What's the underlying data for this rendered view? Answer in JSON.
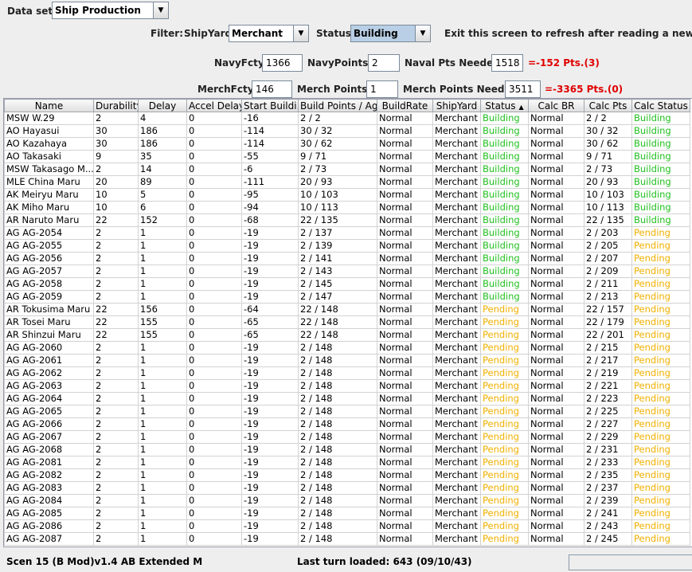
{
  "dataset": {
    "label": "Data set:",
    "value": "Ship Production"
  },
  "filter": {
    "label": "Filter:",
    "shipyard_label": "ShipYard:",
    "shipyard_value": "Merchant",
    "status_label": "Status:",
    "status_value": "Building",
    "exit_message": "Exit this screen to refresh after reading a new turn"
  },
  "navy": {
    "fcty_label": "NavyFcty:",
    "fcty_value": "1366",
    "points_label": "NavyPoints:",
    "points_value": "2",
    "needed_label": "Naval Pts Needed:",
    "needed_value": "1518",
    "deficit": "=-152 Pts.(3)"
  },
  "merch": {
    "fcty_label": "MerchFcty:",
    "fcty_value": "146",
    "points_label": "Merch Points:",
    "points_value": "1",
    "needed_label": "Merch Points Needed:",
    "needed_value": "3511",
    "deficit": "=-3365 Pts.(0)"
  },
  "table": {
    "columns": [
      "Name",
      "Durability",
      "Delay",
      "Accel Delay",
      "Start Buildi...",
      "Build Points / Ag...",
      "BuildRate",
      "ShipYard",
      "Status",
      "Calc BR",
      "Calc Pts",
      "Calc Status"
    ],
    "sort_indicator": "▲",
    "rows": [
      [
        "MSW W.29",
        "2",
        "4",
        "0",
        "-16",
        "2 / 2",
        "Normal",
        "Merchant",
        "Building",
        "Normal",
        "2 / 2",
        "Building"
      ],
      [
        "AO Hayasui",
        "30",
        "186",
        "0",
        "-114",
        "30 / 32",
        "Normal",
        "Merchant",
        "Building",
        "Normal",
        "30 / 32",
        "Building"
      ],
      [
        "AO Kazahaya",
        "30",
        "186",
        "0",
        "-114",
        "30 / 62",
        "Normal",
        "Merchant",
        "Building",
        "Normal",
        "30 / 62",
        "Building"
      ],
      [
        "AO Takasaki",
        "9",
        "35",
        "0",
        "-55",
        "9 / 71",
        "Normal",
        "Merchant",
        "Building",
        "Normal",
        "9 / 71",
        "Building"
      ],
      [
        "MSW Takasago M...",
        "2",
        "14",
        "0",
        "-6",
        "2 / 73",
        "Normal",
        "Merchant",
        "Building",
        "Normal",
        "2 / 73",
        "Building"
      ],
      [
        "MLE China Maru",
        "20",
        "89",
        "0",
        "-111",
        "20 / 93",
        "Normal",
        "Merchant",
        "Building",
        "Normal",
        "20 / 93",
        "Building"
      ],
      [
        "AK Meiryu Maru",
        "10",
        "5",
        "0",
        "-95",
        "10 / 103",
        "Normal",
        "Merchant",
        "Building",
        "Normal",
        "10 / 103",
        "Building"
      ],
      [
        "AK Miho Maru",
        "10",
        "6",
        "0",
        "-94",
        "10 / 113",
        "Normal",
        "Merchant",
        "Building",
        "Normal",
        "10 / 113",
        "Building"
      ],
      [
        "AR Naruto Maru",
        "22",
        "152",
        "0",
        "-68",
        "22 / 135",
        "Normal",
        "Merchant",
        "Building",
        "Normal",
        "22 / 135",
        "Building"
      ],
      [
        "AG AG-2054",
        "2",
        "1",
        "0",
        "-19",
        "2 / 137",
        "Normal",
        "Merchant",
        "Building",
        "Normal",
        "2 / 203",
        "Pending"
      ],
      [
        "AG AG-2055",
        "2",
        "1",
        "0",
        "-19",
        "2 / 139",
        "Normal",
        "Merchant",
        "Building",
        "Normal",
        "2 / 205",
        "Pending"
      ],
      [
        "AG AG-2056",
        "2",
        "1",
        "0",
        "-19",
        "2 / 141",
        "Normal",
        "Merchant",
        "Building",
        "Normal",
        "2 / 207",
        "Pending"
      ],
      [
        "AG AG-2057",
        "2",
        "1",
        "0",
        "-19",
        "2 / 143",
        "Normal",
        "Merchant",
        "Building",
        "Normal",
        "2 / 209",
        "Pending"
      ],
      [
        "AG AG-2058",
        "2",
        "1",
        "0",
        "-19",
        "2 / 145",
        "Normal",
        "Merchant",
        "Building",
        "Normal",
        "2 / 211",
        "Pending"
      ],
      [
        "AG AG-2059",
        "2",
        "1",
        "0",
        "-19",
        "2 / 147",
        "Normal",
        "Merchant",
        "Building",
        "Normal",
        "2 / 213",
        "Pending"
      ],
      [
        "AR Tokusima Maru",
        "22",
        "156",
        "0",
        "-64",
        "22 / 148",
        "Normal",
        "Merchant",
        "Pending",
        "Normal",
        "22 / 157",
        "Pending"
      ],
      [
        "AR Tosei Maru",
        "22",
        "155",
        "0",
        "-65",
        "22 / 148",
        "Normal",
        "Merchant",
        "Pending",
        "Normal",
        "22 / 179",
        "Pending"
      ],
      [
        "AR Shinzui Maru",
        "22",
        "155",
        "0",
        "-65",
        "22 / 148",
        "Normal",
        "Merchant",
        "Pending",
        "Normal",
        "22 / 201",
        "Pending"
      ],
      [
        "AG AG-2060",
        "2",
        "1",
        "0",
        "-19",
        "2 / 148",
        "Normal",
        "Merchant",
        "Pending",
        "Normal",
        "2 / 215",
        "Pending"
      ],
      [
        "AG AG-2061",
        "2",
        "1",
        "0",
        "-19",
        "2 / 148",
        "Normal",
        "Merchant",
        "Pending",
        "Normal",
        "2 / 217",
        "Pending"
      ],
      [
        "AG AG-2062",
        "2",
        "1",
        "0",
        "-19",
        "2 / 148",
        "Normal",
        "Merchant",
        "Pending",
        "Normal",
        "2 / 219",
        "Pending"
      ],
      [
        "AG AG-2063",
        "2",
        "1",
        "0",
        "-19",
        "2 / 148",
        "Normal",
        "Merchant",
        "Pending",
        "Normal",
        "2 / 221",
        "Pending"
      ],
      [
        "AG AG-2064",
        "2",
        "1",
        "0",
        "-19",
        "2 / 148",
        "Normal",
        "Merchant",
        "Pending",
        "Normal",
        "2 / 223",
        "Pending"
      ],
      [
        "AG AG-2065",
        "2",
        "1",
        "0",
        "-19",
        "2 / 148",
        "Normal",
        "Merchant",
        "Pending",
        "Normal",
        "2 / 225",
        "Pending"
      ],
      [
        "AG AG-2066",
        "2",
        "1",
        "0",
        "-19",
        "2 / 148",
        "Normal",
        "Merchant",
        "Pending",
        "Normal",
        "2 / 227",
        "Pending"
      ],
      [
        "AG AG-2067",
        "2",
        "1",
        "0",
        "-19",
        "2 / 148",
        "Normal",
        "Merchant",
        "Pending",
        "Normal",
        "2 / 229",
        "Pending"
      ],
      [
        "AG AG-2068",
        "2",
        "1",
        "0",
        "-19",
        "2 / 148",
        "Normal",
        "Merchant",
        "Pending",
        "Normal",
        "2 / 231",
        "Pending"
      ],
      [
        "AG AG-2081",
        "2",
        "1",
        "0",
        "-19",
        "2 / 148",
        "Normal",
        "Merchant",
        "Pending",
        "Normal",
        "2 / 233",
        "Pending"
      ],
      [
        "AG AG-2082",
        "2",
        "1",
        "0",
        "-19",
        "2 / 148",
        "Normal",
        "Merchant",
        "Pending",
        "Normal",
        "2 / 235",
        "Pending"
      ],
      [
        "AG AG-2083",
        "2",
        "1",
        "0",
        "-19",
        "2 / 148",
        "Normal",
        "Merchant",
        "Pending",
        "Normal",
        "2 / 237",
        "Pending"
      ],
      [
        "AG AG-2084",
        "2",
        "1",
        "0",
        "-19",
        "2 / 148",
        "Normal",
        "Merchant",
        "Pending",
        "Normal",
        "2 / 239",
        "Pending"
      ],
      [
        "AG AG-2085",
        "2",
        "1",
        "0",
        "-19",
        "2 / 148",
        "Normal",
        "Merchant",
        "Pending",
        "Normal",
        "2 / 241",
        "Pending"
      ],
      [
        "AG AG-2086",
        "2",
        "1",
        "0",
        "-19",
        "2 / 148",
        "Normal",
        "Merchant",
        "Pending",
        "Normal",
        "2 / 243",
        "Pending"
      ],
      [
        "AG AG-2087",
        "2",
        "1",
        "0",
        "-19",
        "2 / 148",
        "Normal",
        "Merchant",
        "Pending",
        "Normal",
        "2 / 245",
        "Pending"
      ]
    ]
  },
  "status_bar": {
    "scenario": "Scen 15 (B Mod)v1.4 AB Extended M",
    "last_turn": "Last turn loaded: 643 (09/10/43)"
  },
  "colors": {
    "building": "#22c020",
    "pending": "#f0b000",
    "deficit": "#e00000"
  },
  "icons": {
    "combo_arrow": "chevron-down-icon",
    "sort": "sort-asc-icon"
  }
}
